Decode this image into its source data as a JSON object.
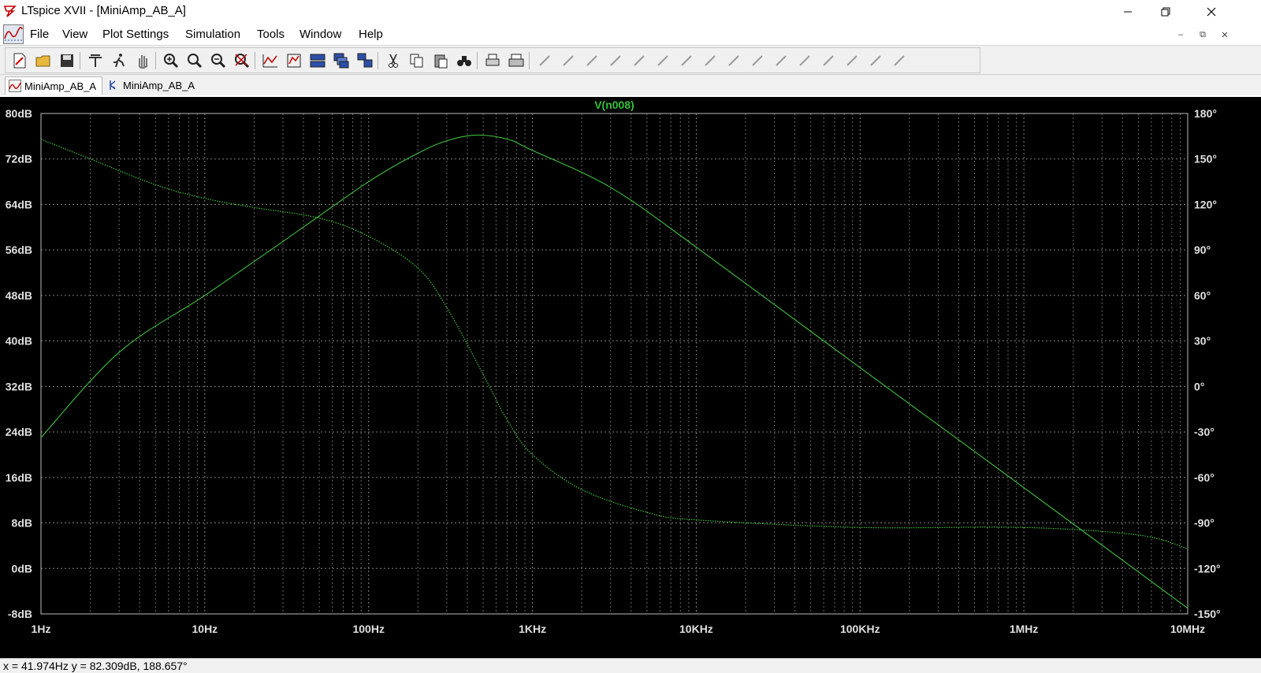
{
  "window": {
    "title": "LTspice XVII - [MiniAmp_AB_A]",
    "controls": [
      "minimize",
      "restore",
      "close"
    ]
  },
  "menu": [
    "File",
    "View",
    "Plot Settings",
    "Simulation",
    "Tools",
    "Window",
    "Help"
  ],
  "mdi_controls": [
    "minimize",
    "restore",
    "close"
  ],
  "toolbar": [
    "new-schematic-icon",
    "open-icon",
    "save-icon",
    "control-panel-icon",
    "run-icon",
    "halt-icon",
    "zoom-in-icon",
    "zoom-area-icon",
    "zoom-out-icon",
    "zoom-fit-icon",
    "autorange-icon",
    "plot-settings-icon",
    "tile-horizontal-icon",
    "cascade-icon",
    "arrange-icon",
    "cut-icon",
    "copy-icon",
    "paste-icon",
    "find-icon",
    "print-preview-icon",
    "print-icon",
    "wire-icon",
    "ground-icon",
    "label-icon",
    "resistor-icon",
    "capacitor-icon",
    "inductor-icon",
    "diode-icon",
    "component-icon",
    "move-icon",
    "drag-icon",
    "undo-icon",
    "redo-icon",
    "rotate-icon",
    "mirror-icon",
    "text-icon",
    "spice-directive-icon"
  ],
  "tabs": [
    {
      "label": "MiniAmp_AB_A",
      "icon": "waveform-icon",
      "active": true
    },
    {
      "label": "MiniAmp_AB_A",
      "icon": "schematic-icon",
      "active": false
    }
  ],
  "status": "x = 41.974Hz    y = 82.309dB, 188.657°",
  "colors": {
    "trace": "#3fc03f",
    "title": "#35c235",
    "axis_text": "#e0e0e0",
    "grid": "#8c8c8c",
    "background": "#000000"
  },
  "chart_data": {
    "type": "line",
    "title": "V(n008)",
    "x_scale": "log",
    "xlim": [
      "1Hz",
      "10MHz"
    ],
    "x_ticks": [
      "1Hz",
      "10Hz",
      "100Hz",
      "1KHz",
      "10KHz",
      "100KHz",
      "1MHz",
      "10MHz"
    ],
    "y_left_ticks": [
      "80dB",
      "72dB",
      "64dB",
      "56dB",
      "48dB",
      "40dB",
      "32dB",
      "24dB",
      "16dB",
      "8dB",
      "0dB",
      "-8dB"
    ],
    "y_right_ticks": [
      "180°",
      "150°",
      "120°",
      "90°",
      "60°",
      "30°",
      "0°",
      "-30°",
      "-60°",
      "-90°",
      "-120°",
      "-150°"
    ],
    "ylim_left": [
      -8,
      80
    ],
    "ylim_right": [
      -150,
      180
    ],
    "grid": true,
    "series": [
      {
        "name": "V(n008)",
        "kind": "magnitude",
        "axis": "left",
        "style": "solid",
        "x": [
          "1Hz",
          "3Hz",
          "10Hz",
          "30Hz",
          "100Hz",
          "200Hz",
          "300Hz",
          "450Hz",
          "700Hz",
          "1KHz",
          "3KHz",
          "10KHz",
          "100KHz",
          "1MHz",
          "10MHz"
        ],
        "y": [
          23,
          38,
          48,
          57.5,
          68,
          73,
          75.2,
          76.2,
          75.5,
          73.5,
          67,
          56.5,
          35.3,
          14.2,
          -7
        ]
      },
      {
        "name": "V(n008)",
        "kind": "phase",
        "axis": "right",
        "style": "dotted",
        "x": [
          "1Hz",
          "2Hz",
          "5Hz",
          "10Hz",
          "20Hz",
          "50Hz",
          "100Hz",
          "200Hz",
          "300Hz",
          "500Hz",
          "700Hz",
          "1KHz",
          "2KHz",
          "5KHz",
          "10KHz",
          "100KHz",
          "1MHz",
          "5MHz",
          "10MHz"
        ],
        "y": [
          163,
          150,
          133,
          124,
          118,
          111,
          99,
          78,
          52,
          8,
          -22,
          -45,
          -68,
          -83,
          -88,
          -93,
          -93,
          -98,
          -107
        ]
      }
    ]
  }
}
